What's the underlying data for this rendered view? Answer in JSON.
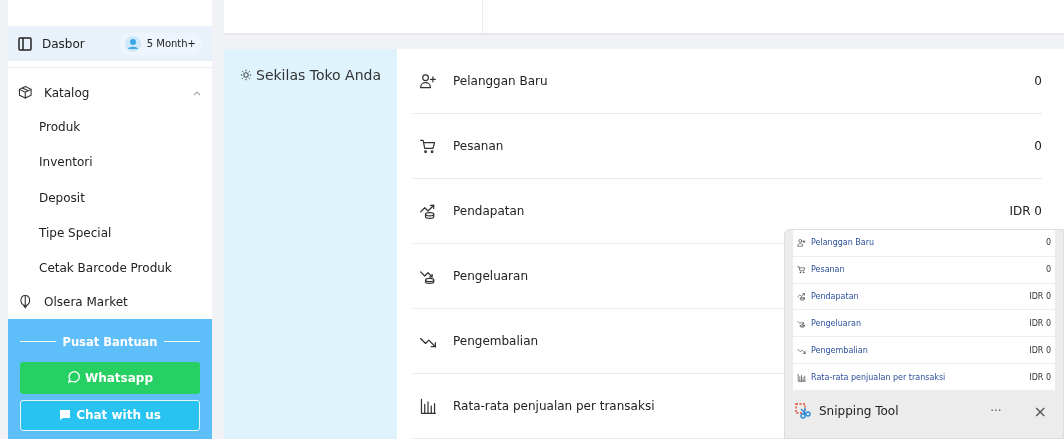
{
  "sidebar": {
    "top_item": {
      "label": "Dasbor",
      "badge": "5 Month+",
      "selected": true
    },
    "items": [
      {
        "label": "Katalog",
        "expanded": true,
        "children": [
          {
            "label": "Produk"
          },
          {
            "label": "Inventori"
          },
          {
            "label": "Deposit"
          },
          {
            "label": "Tipe Special"
          },
          {
            "label": "Cetak Barcode Produk"
          }
        ]
      },
      {
        "label": "Olsera Market"
      }
    ],
    "help": {
      "title": "Pusat Bantuan",
      "buttons": [
        {
          "label": "Whatsapp",
          "kind": "whatsapp"
        },
        {
          "label": "Chat with us",
          "kind": "chat"
        }
      ]
    }
  },
  "overview": {
    "title": "Sekilas Toko Anda",
    "rows": [
      {
        "label": "Pelanggan Baru",
        "value": "0"
      },
      {
        "label": "Pesanan",
        "value": "0"
      },
      {
        "label": "Pendapatan",
        "value": "IDR 0"
      },
      {
        "label": "Pengeluaran"
      },
      {
        "label": "Pengembalian"
      },
      {
        "label": "Rata-rata penjualan per transaksi"
      }
    ]
  },
  "snipping_tool": {
    "title": "Snipping Tool",
    "more": "···",
    "close": "×",
    "preview_rows": [
      {
        "label": "Pelanggan Baru",
        "value": "0"
      },
      {
        "label": "Pesanan",
        "value": "0"
      },
      {
        "label": "Pendapatan",
        "value": "IDR 0"
      },
      {
        "label": "Pengeluaran",
        "value": "IDR 0"
      },
      {
        "label": "Pengembalian",
        "value": "IDR 0"
      },
      {
        "label": "Rata-rata penjualan per transaksi",
        "value": "IDR 0"
      }
    ]
  }
}
